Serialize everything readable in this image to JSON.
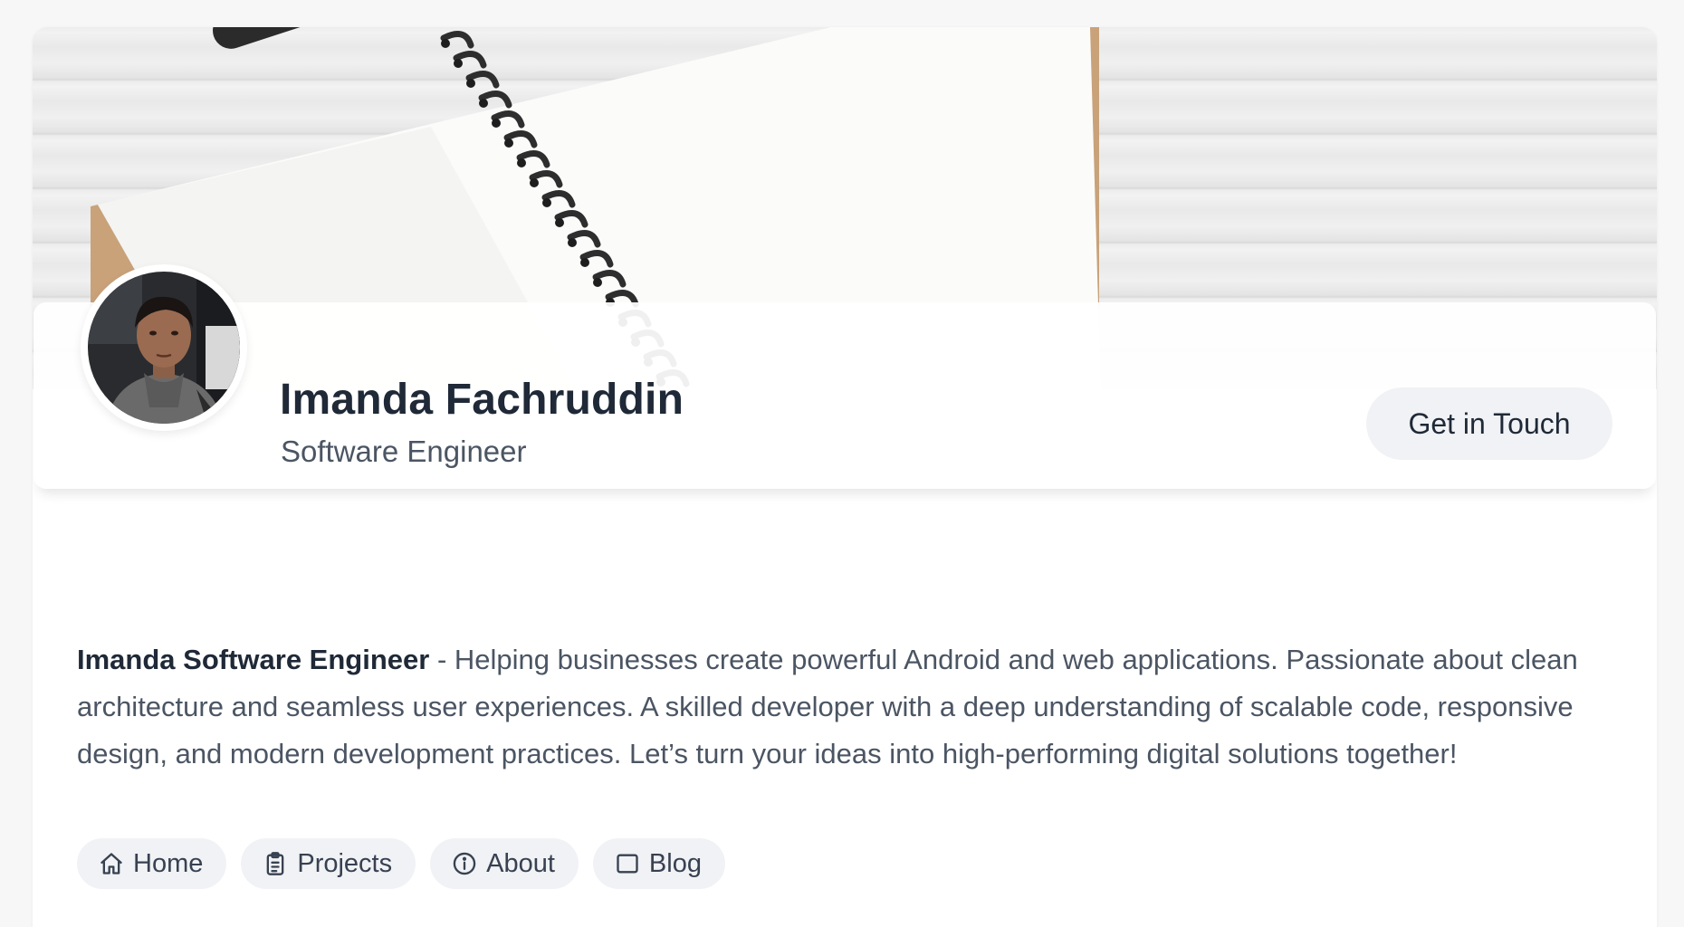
{
  "profile": {
    "name": "Imanda Fachruddin",
    "role": "Software Engineer",
    "cta_label": "Get in Touch"
  },
  "intro": {
    "highlight": "Imanda Software Engineer",
    "text": " - Helping businesses create powerful Android and web applications. Passionate about clean architecture and seamless user experiences. A skilled developer with a deep understanding of scalable code, responsive design, and modern development practices. Let’s turn your ideas into high-performing digital solutions together!"
  },
  "nav": {
    "items": [
      {
        "label": "Home",
        "icon": "home-icon"
      },
      {
        "label": "Projects",
        "icon": "clipboard-icon"
      },
      {
        "label": "About",
        "icon": "info-icon"
      },
      {
        "label": "Blog",
        "icon": "square-icon"
      }
    ]
  },
  "colors": {
    "page_bg": "#f7f7f7",
    "card_bg": "#ffffff",
    "pill_bg": "#f1f2f5",
    "heading": "#1f2937",
    "body_text": "#4b5563"
  }
}
